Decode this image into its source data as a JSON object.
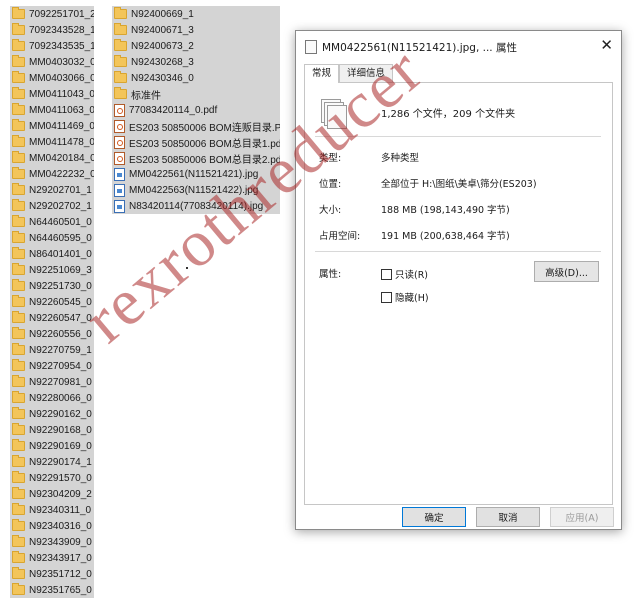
{
  "left_list": [
    "7092251701_2",
    "7092343528_1",
    "7092343535_1",
    "MM0403032_0",
    "MM0403066_0",
    "MM0411043_0",
    "MM0411063_0",
    "MM0411469_0",
    "MM0411478_0",
    "MM0420184_0",
    "MM0422232_0",
    "N29202701_1",
    "N29202702_1",
    "N64460501_0",
    "N64460595_0",
    "N86401401_0",
    "N92251069_3",
    "N92251730_0",
    "N92260545_0",
    "N92260547_0",
    "N92260556_0",
    "N92270759_1",
    "N92270954_0",
    "N92270981_0",
    "N92280066_0",
    "N92290162_0",
    "N92290168_0",
    "N92290169_0",
    "N92290174_1",
    "N92291570_0",
    "N92304209_2",
    "N92340311_0",
    "N92340316_0",
    "N92343909_0",
    "N92343917_0",
    "N92351712_0",
    "N92351765_0"
  ],
  "mid_list": [
    {
      "name": "N92400669_1",
      "icon": "folder-icon"
    },
    {
      "name": "N92400671_3",
      "icon": "folder-icon"
    },
    {
      "name": "N92400673_2",
      "icon": "folder-icon"
    },
    {
      "name": "N92430268_3",
      "icon": "folder-icon"
    },
    {
      "name": "N92430346_0",
      "icon": "folder-icon"
    },
    {
      "name": "标准件",
      "icon": "folder-icon"
    },
    {
      "name": "77083420114_0.pdf",
      "icon": "pdf-icon"
    },
    {
      "name": "ES203  50850006 BOM连贩目录.PDF",
      "icon": "pdf-icon"
    },
    {
      "name": "ES203  50850006 BOM总目录1.pdf",
      "icon": "pdf-icon"
    },
    {
      "name": "ES203  50850006 BOM总目录2.pdf",
      "icon": "pdf-icon"
    },
    {
      "name": "MM0422561(N11521421).jpg",
      "icon": "jpg-icon"
    },
    {
      "name": "MM0422563(N11521422).jpg",
      "icon": "jpg-icon"
    },
    {
      "name": "N83420114(77083420114).jpg",
      "icon": "jpg-icon"
    }
  ],
  "dialog": {
    "title": "MM0422561(N11521421).jpg, ... 属性",
    "close": "✕",
    "tabs": [
      "常规",
      "详细信息"
    ],
    "summary": "1,286 个文件，209 个文件夹",
    "type_label": "类型:",
    "type_value": "多种类型",
    "location_label": "位置:",
    "location_value": "全部位于 H:\\图纸\\美卓\\筛分(ES203)",
    "size_label": "大小:",
    "size_value": "188 MB (198,143,490 字节)",
    "disk_label": "占用空间:",
    "disk_value": "191 MB (200,638,464 字节)",
    "attr_label": "属性:",
    "readonly_label": "只读(R)",
    "hidden_label": "隐藏(H)",
    "advanced_button": "高级(D)...",
    "ok_button": "确定",
    "cancel_button": "取消",
    "apply_button": "应用(A)"
  },
  "watermark": "rexrothreducer",
  "colors": {
    "row_bg": "#d4d4d4",
    "folder": "#f3c55a",
    "watermark": "#aa2828",
    "accent": "#0078d7"
  }
}
